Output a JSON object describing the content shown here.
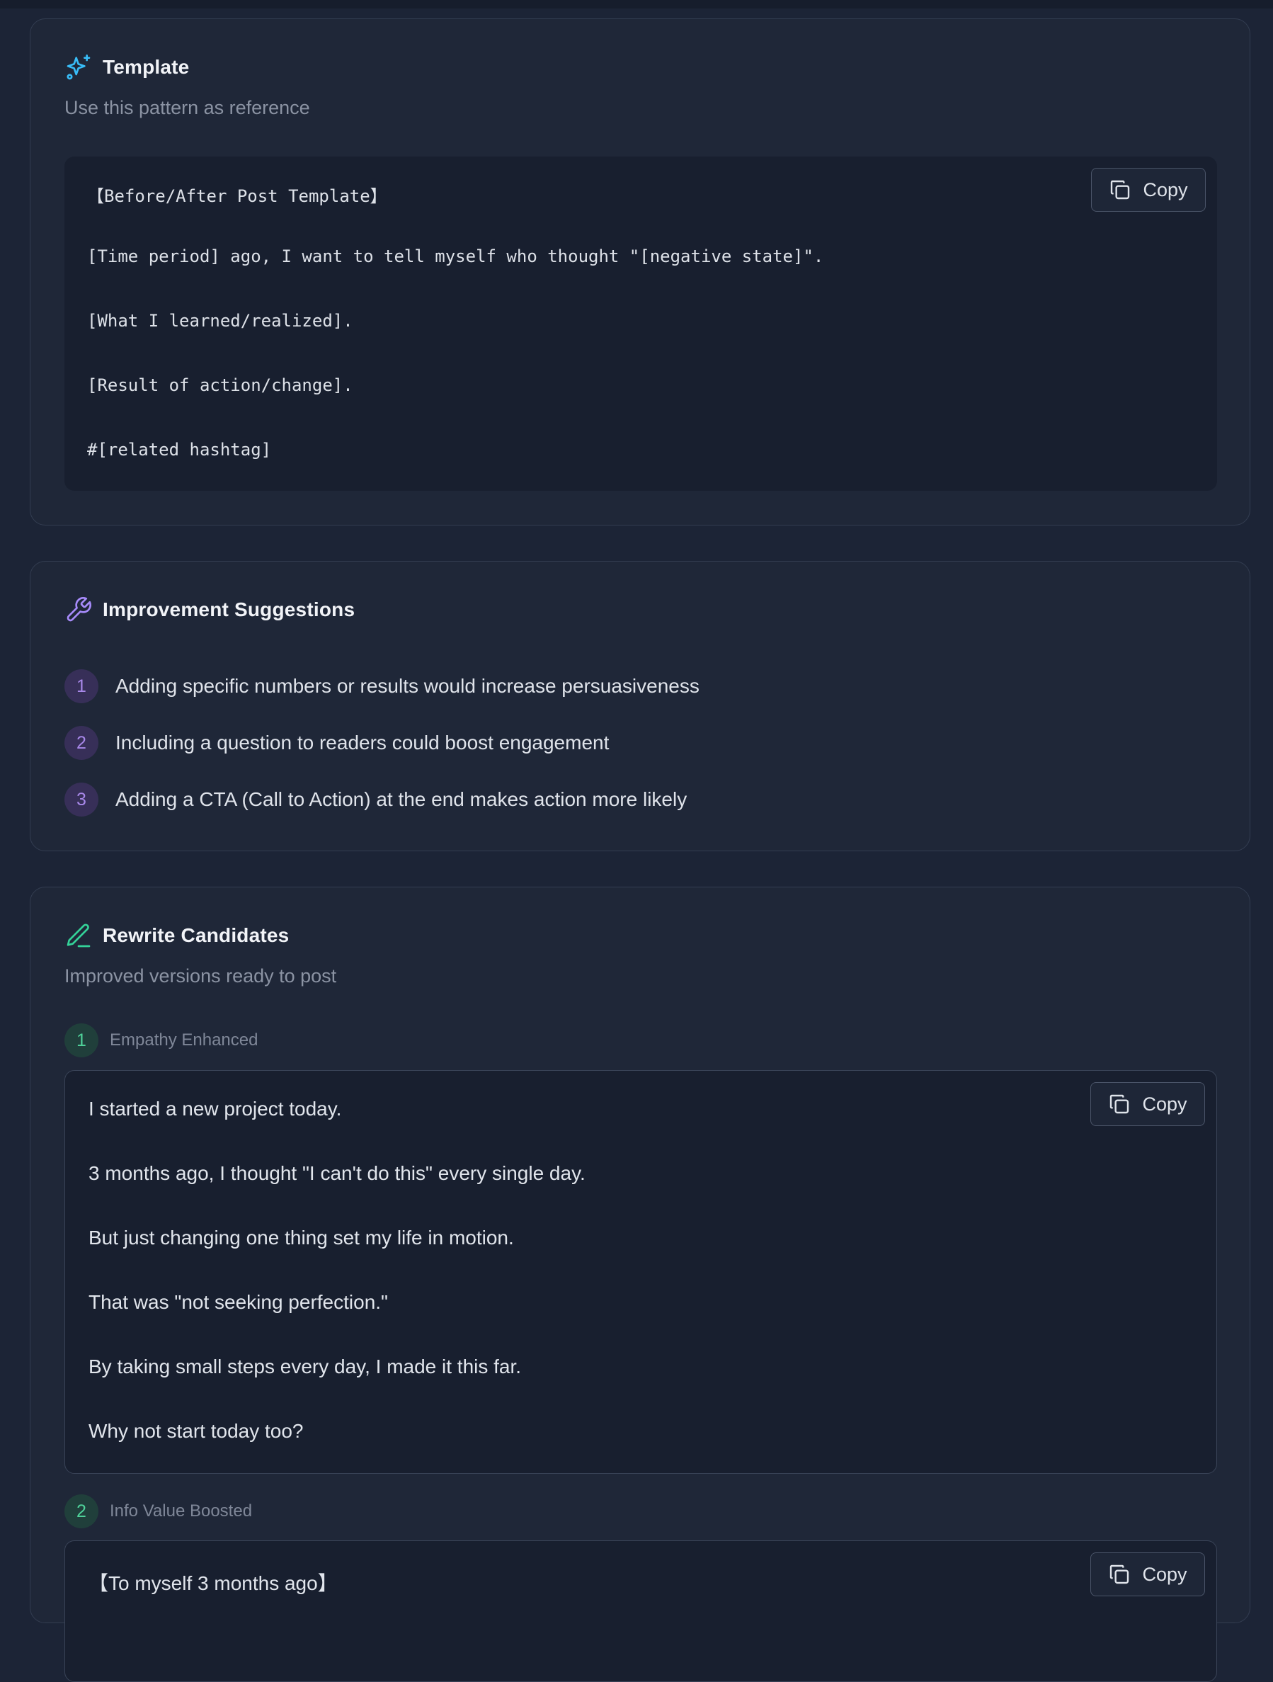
{
  "template_card": {
    "title": "Template",
    "subtitle": "Use this pattern as reference",
    "copy_label": "Copy",
    "lines": [
      "【Before/After Post Template】",
      "[Time period] ago, I want to tell myself who thought \"[negative state]\".",
      "[What I learned/realized].",
      "[Result of action/change].",
      "#[related hashtag]"
    ],
    "icon": "sparkles-icon",
    "icon_color": "#38bdf8"
  },
  "suggestions_card": {
    "title": "Improvement Suggestions",
    "icon": "wrench-icon",
    "icon_color": "#a78bfa",
    "items": [
      {
        "num": "1",
        "text": "Adding specific numbers or results would increase persuasiveness"
      },
      {
        "num": "2",
        "text": "Including a question to readers could boost engagement"
      },
      {
        "num": "3",
        "text": "Adding a CTA (Call to Action) at the end makes action more likely"
      }
    ]
  },
  "rewrite_card": {
    "title": "Rewrite Candidates",
    "subtitle": "Improved versions ready to post",
    "icon": "pen-icon",
    "icon_color": "#34d399",
    "candidates": [
      {
        "num": "1",
        "label": "Empathy Enhanced",
        "copy_label": "Copy",
        "lines": [
          "I started a new project today.",
          "3 months ago, I thought \"I can't do this\" every single day.",
          "But just changing one thing set my life in motion.",
          "That was \"not seeking perfection.\"",
          "By taking small steps every day, I made it this far.",
          "Why not start today too?"
        ]
      },
      {
        "num": "2",
        "label": "Info Value Boosted",
        "copy_label": "Copy",
        "lines": [
          "【To myself 3 months ago】"
        ]
      }
    ]
  }
}
